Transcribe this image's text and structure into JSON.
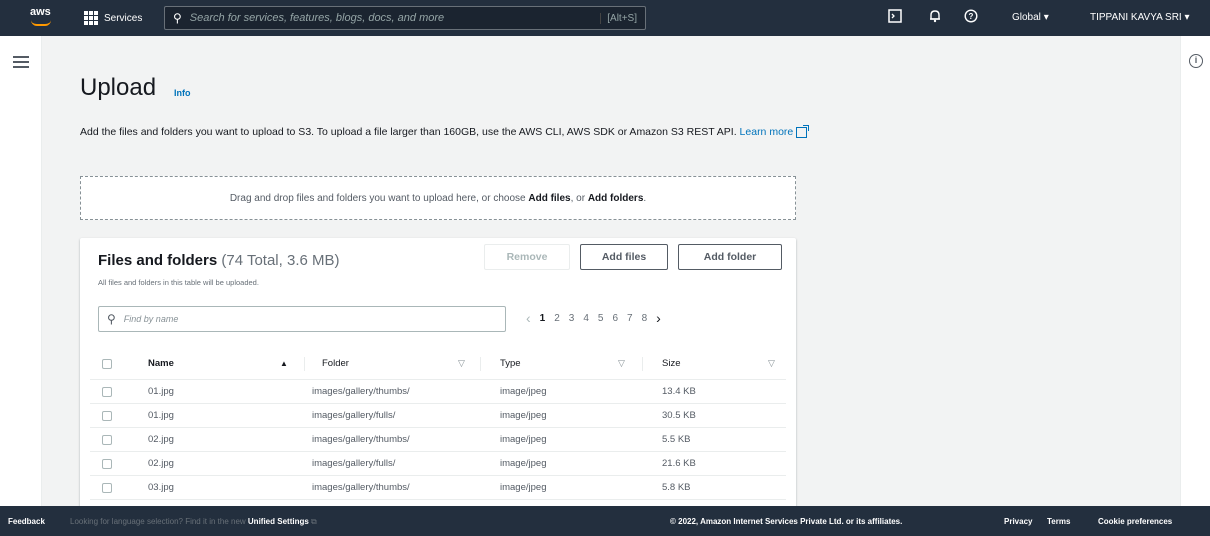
{
  "topnav": {
    "logo": "aws",
    "services_label": "Services",
    "search_placeholder": "Search for services, features, blogs, docs, and more",
    "search_shortcut": "[Alt+S]",
    "region": "Global",
    "user": "TIPPANI KAVYA SRI"
  },
  "page": {
    "title": "Upload",
    "info": "Info",
    "description": "Add the files and folders you want to upload to S3. To upload a file larger than 160GB, use the AWS CLI, AWS SDK or Amazon S3 REST API.",
    "learn_more": "Learn more"
  },
  "dropzone": {
    "text_before": "Drag and drop files and folders you want to upload here, or choose ",
    "add_files": "Add files",
    "or": ", or ",
    "add_folders": "Add folders",
    "end": "."
  },
  "panel": {
    "title": "Files and folders",
    "count": "(74 Total, 3.6 MB)",
    "subtitle": "All files and folders in this table will be uploaded.",
    "remove_label": "Remove",
    "add_files_label": "Add files",
    "add_folder_label": "Add folder",
    "filter_placeholder": "Find by name",
    "pages": [
      "1",
      "2",
      "3",
      "4",
      "5",
      "6",
      "7",
      "8"
    ],
    "current_page": "1"
  },
  "table": {
    "columns": [
      "Name",
      "Folder",
      "Type",
      "Size"
    ],
    "rows": [
      {
        "name": "01.jpg",
        "folder": "images/gallery/thumbs/",
        "type": "image/jpeg",
        "size": "13.4 KB"
      },
      {
        "name": "01.jpg",
        "folder": "images/gallery/fulls/",
        "type": "image/jpeg",
        "size": "30.5 KB"
      },
      {
        "name": "02.jpg",
        "folder": "images/gallery/thumbs/",
        "type": "image/jpeg",
        "size": "5.5 KB"
      },
      {
        "name": "02.jpg",
        "folder": "images/gallery/fulls/",
        "type": "image/jpeg",
        "size": "21.6 KB"
      },
      {
        "name": "03.jpg",
        "folder": "images/gallery/thumbs/",
        "type": "image/jpeg",
        "size": "5.8 KB"
      }
    ]
  },
  "footer": {
    "feedback": "Feedback",
    "language_note": "Looking for language selection? Find it in the new ",
    "unified_settings": "Unified Settings",
    "copyright": "© 2022, Amazon Internet Services Private Ltd. or its affiliates.",
    "privacy": "Privacy",
    "terms": "Terms",
    "cookie": "Cookie preferences"
  }
}
